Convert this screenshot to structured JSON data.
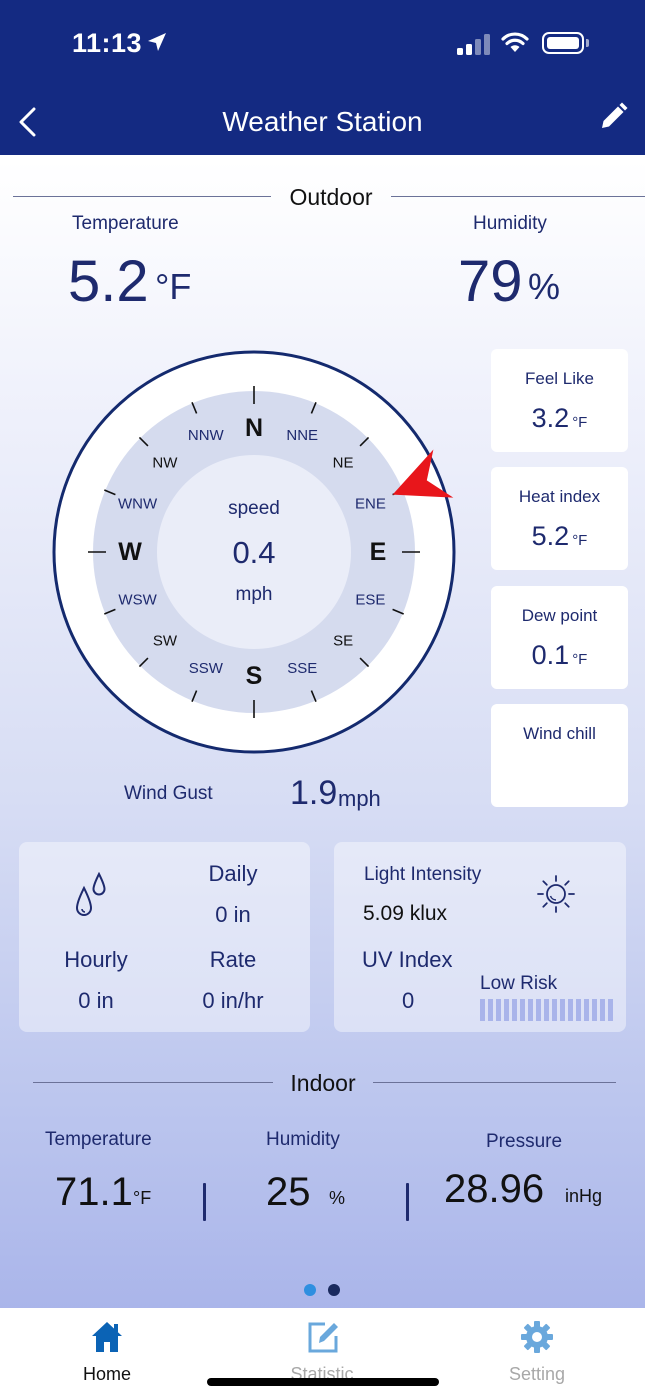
{
  "status_bar": {
    "time": "11:13"
  },
  "header": {
    "title": "Weather Station",
    "back_icon": "chevron-left-icon",
    "edit_icon": "pencil-icon"
  },
  "outdoor": {
    "section_title": "Outdoor",
    "temperature": {
      "label": "Temperature",
      "value": "5.2",
      "unit": "°F"
    },
    "humidity": {
      "label": "Humidity",
      "value": "79",
      "unit": "%"
    },
    "compass": {
      "center_label": "speed",
      "center_value": "0.4",
      "center_unit": "mph",
      "wind_direction_deg": 67.5,
      "directions": [
        "N",
        "NNE",
        "NE",
        "ENE",
        "E",
        "ESE",
        "SE",
        "SSE",
        "S",
        "SSW",
        "SW",
        "WSW",
        "W",
        "WNW",
        "NW",
        "NNW"
      ]
    },
    "wind_gust": {
      "label": "Wind Gust",
      "value": "1.9",
      "unit": "mph"
    },
    "cards": [
      {
        "label": "Feel Like",
        "value": "3.2",
        "unit": "°F"
      },
      {
        "label": "Heat index",
        "value": "5.2",
        "unit": "°F"
      },
      {
        "label": "Dew point",
        "value": "0.1",
        "unit": "°F"
      },
      {
        "label": "Wind chill",
        "value": "",
        "unit": ""
      }
    ],
    "rain": {
      "daily_label": "Daily",
      "daily_value": "0 in",
      "hourly_label": "Hourly",
      "hourly_value": "0 in",
      "rate_label": "Rate",
      "rate_value": "0 in/hr"
    },
    "light": {
      "intensity_label": "Light Intensity",
      "intensity_value": "5.09 klux",
      "uv_label": "UV Index",
      "uv_value": "0",
      "risk_label": "Low Risk"
    }
  },
  "indoor": {
    "section_title": "Indoor",
    "temperature": {
      "label": "Temperature",
      "value": "71.1",
      "unit": "°F"
    },
    "humidity": {
      "label": "Humidity",
      "value": "25",
      "unit": "%"
    },
    "pressure": {
      "label": "Pressure",
      "value": "28.96",
      "unit": "inHg"
    }
  },
  "pager": {
    "pages": 2,
    "current": 1
  },
  "tabs": [
    {
      "label": "Home",
      "icon": "house-icon",
      "active": true
    },
    {
      "label": "Statistic",
      "icon": "edit-square-icon",
      "active": false
    },
    {
      "label": "Setting",
      "icon": "gear-icon",
      "active": false
    }
  ],
  "colors": {
    "header": "#142a82",
    "accent": "#1e2a6e",
    "wind_arrow": "#e8161b",
    "active_tab": "#0b63b5",
    "inactive_tab": "#6aa8dc"
  }
}
